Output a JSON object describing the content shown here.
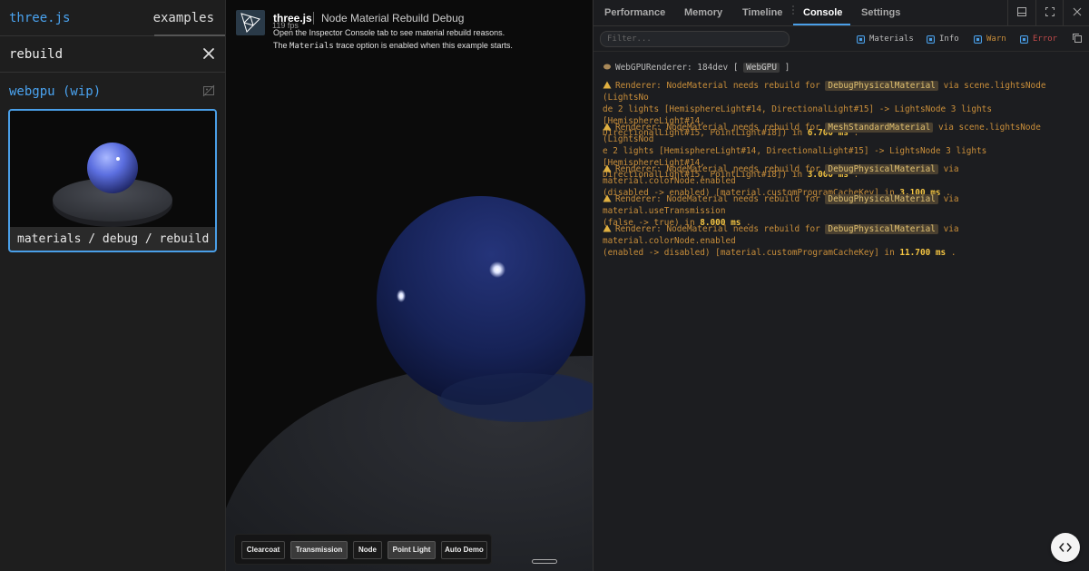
{
  "sidebar": {
    "brand": "three.js",
    "examples_label": "examples",
    "search_value": "rebuild",
    "category": "webgpu (wip)",
    "card_label": "materials / debug / rebuild"
  },
  "viewport": {
    "info_title": "three.js",
    "info_subtitle": "Node Material Rebuild Debug",
    "info_fps": "119 fps",
    "info_line1": "Open the Inspector Console tab to see material rebuild reasons.",
    "info_line2_a": "The ",
    "info_line2_code": "Materials",
    "info_line2_b": " trace option is enabled when this example starts.",
    "buttons": [
      {
        "label": "Clearcoat",
        "active": false
      },
      {
        "label": "Transmission",
        "active": true
      },
      {
        "label": "Node",
        "active": false
      },
      {
        "label": "Point Light",
        "active": true
      },
      {
        "label": "Auto Demo",
        "active": false
      }
    ]
  },
  "inspector": {
    "tabs": [
      "Performance",
      "Memory",
      "Timeline",
      "Console",
      "Settings"
    ],
    "active_tab": "Console",
    "filter_placeholder": "Filter...",
    "checks": [
      {
        "label": "Materials",
        "color": "#bbbbbb"
      },
      {
        "label": "Info",
        "color": "#bbbbbb"
      },
      {
        "label": "Warn",
        "color": "#c98e3a"
      },
      {
        "label": "Error",
        "color": "#c04a4a"
      }
    ],
    "logs": [
      {
        "type": "info",
        "l1": "WebGPURenderer: 184dev [ ",
        "tag": "WebGPU",
        "l1b": " ]"
      },
      {
        "type": "warn",
        "pre": "Renderer: NodeMaterial needs rebuild for ",
        "tag": "DebugPhysicalMaterial",
        "post1": " via scene.lightsNode (LightsNo",
        "line2": "de 2 lights [HemisphereLight#14, DirectionalLight#15] -> LightsNode 3 lights [HemisphereLight#14,",
        "line3a": "DirectionalLight#15, PointLight#18]) in ",
        "ms": "6.700 ms",
        "tail": " ."
      },
      {
        "type": "warn",
        "pre": "Renderer: NodeMaterial needs rebuild for ",
        "tag": "MeshStandardMaterial",
        "post1": " via scene.lightsNode (LightsNod",
        "line2": "e 2 lights [HemisphereLight#14, DirectionalLight#15] -> LightsNode 3 lights [HemisphereLight#14,",
        "line3a": "DirectionalLight#15, PointLight#18]) in ",
        "ms": "3.000 ms",
        "tail": " ."
      },
      {
        "type": "warn",
        "pre": "Renderer: NodeMaterial needs rebuild for ",
        "tag": "DebugPhysicalMaterial",
        "post1": " via material.colorNode.enabled",
        "line2a": "(disabled -> enabled) [material.customProgramCacheKey] in ",
        "ms": "3.100 ms",
        "tail": " ."
      },
      {
        "type": "warn",
        "pre": "Renderer: NodeMaterial needs rebuild for ",
        "tag": "DebugPhysicalMaterial",
        "post1": " via material.useTransmission",
        "line2a": "(false -> true) in ",
        "ms": "8.000 ms",
        "tail": " ."
      },
      {
        "type": "warn",
        "pre": "Renderer: NodeMaterial needs rebuild for ",
        "tag": "DebugPhysicalMaterial",
        "post1": " via material.colorNode.enabled",
        "line2a": "(enabled -> disabled) [material.customProgramCacheKey] in ",
        "ms": "11.700 ms",
        "tail": " ."
      }
    ]
  }
}
